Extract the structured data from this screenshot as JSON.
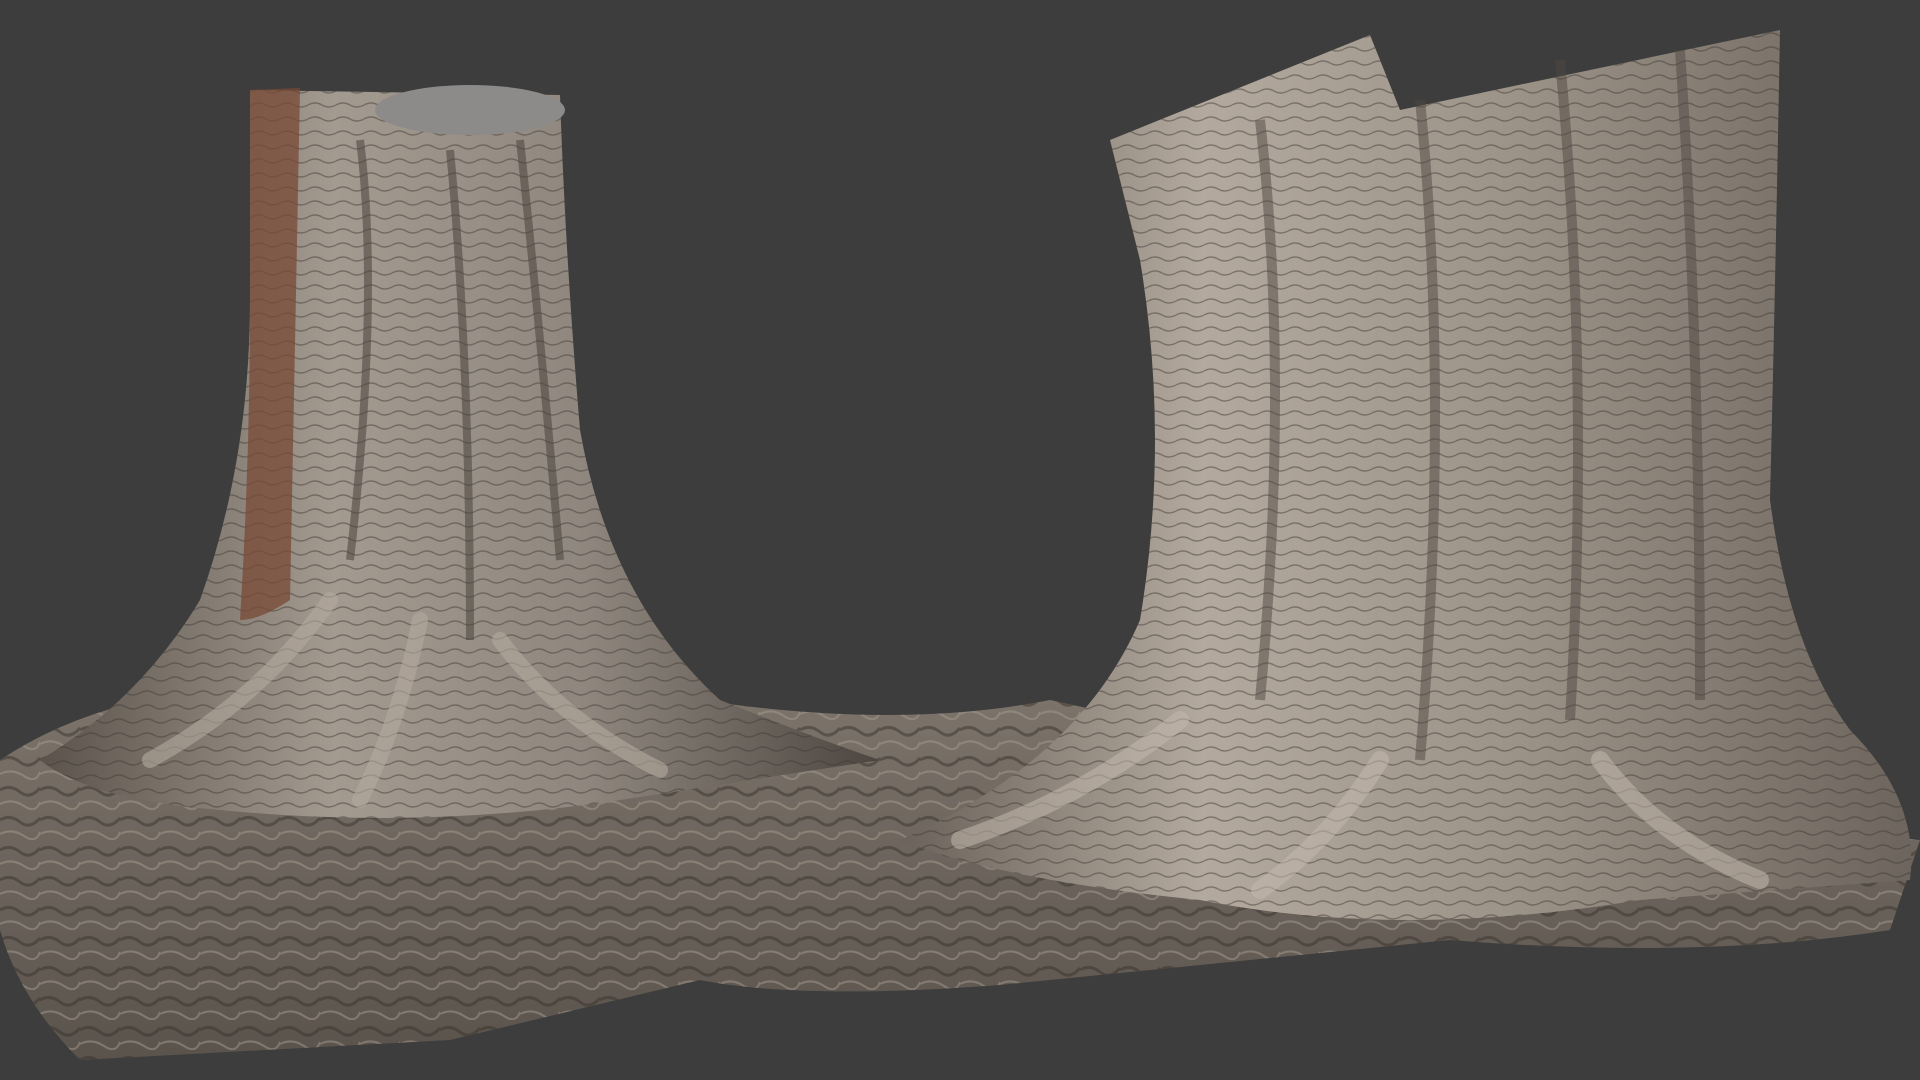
{
  "scene": {
    "background_color": "#3d3d3d",
    "objects": [
      {
        "name": "left-tree-stump",
        "bark_color": "#9c9389"
      },
      {
        "name": "right-tree-stump",
        "bark_color": "#a49a8f"
      }
    ],
    "ground_color": "#6e665e"
  }
}
